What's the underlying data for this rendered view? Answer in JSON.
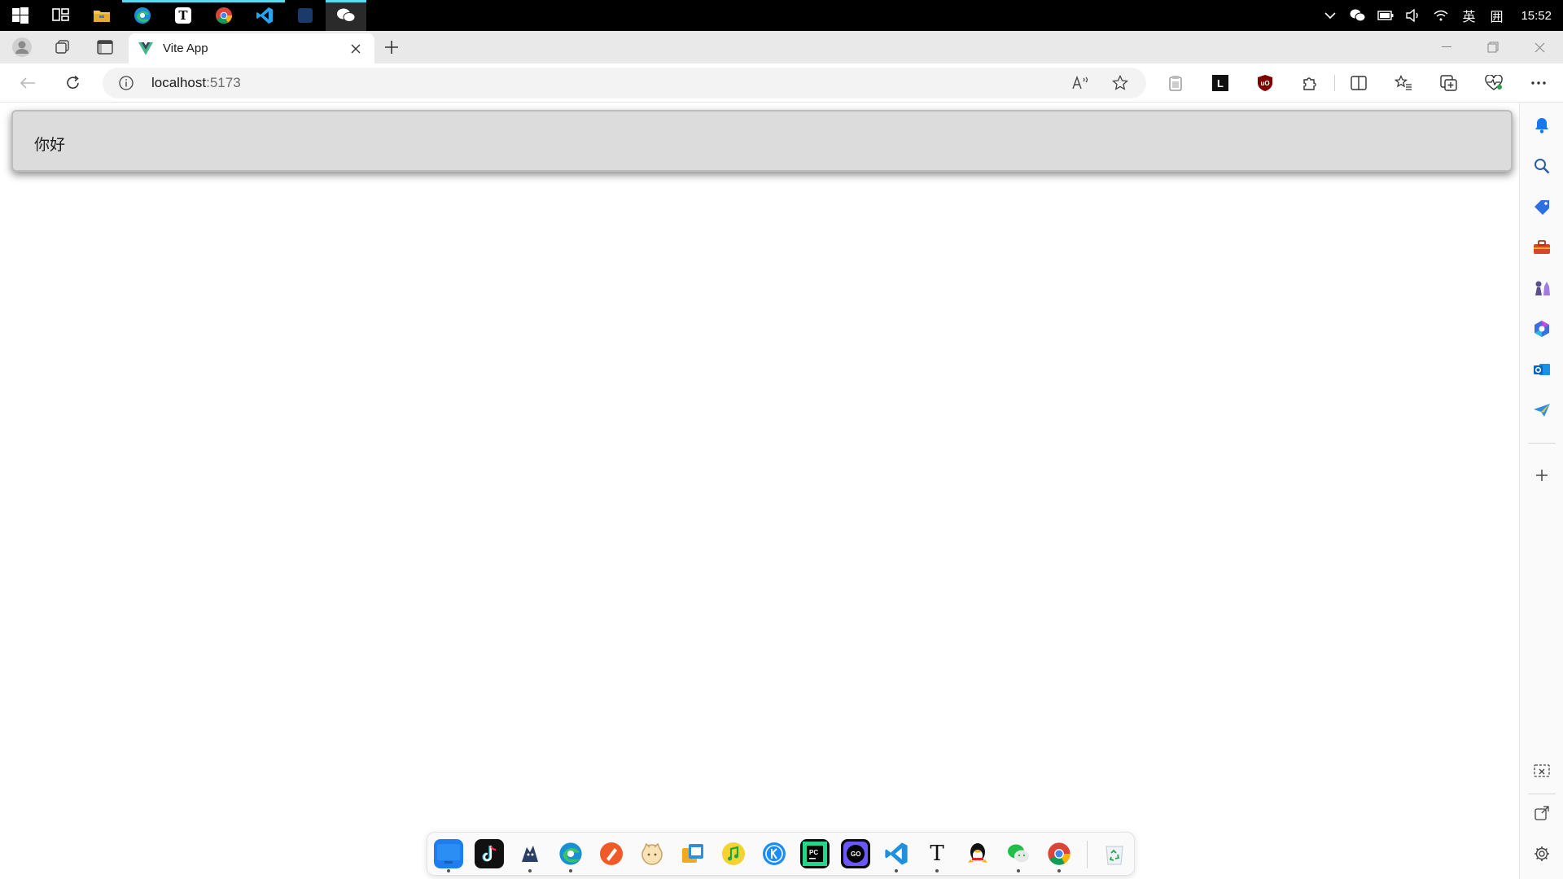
{
  "taskbar": {
    "apps": [
      {
        "name": "start",
        "icon": "windows-logo-icon"
      },
      {
        "name": "task-view",
        "icon": "task-view-icon"
      },
      {
        "name": "file-explorer",
        "icon": "folder-icon"
      },
      {
        "name": "edge",
        "icon": "edge-icon"
      },
      {
        "name": "typora",
        "icon": "typora-icon"
      },
      {
        "name": "chrome",
        "icon": "chrome-icon"
      },
      {
        "name": "vscode",
        "icon": "vscode-icon"
      },
      {
        "name": "penguin",
        "icon": "penguin-icon"
      },
      {
        "name": "wechat",
        "icon": "wechat-icon"
      }
    ],
    "tray": {
      "ime_lang": "英",
      "ime_mode": "囲",
      "time": "15:52"
    }
  },
  "browser": {
    "tab_title": "Vite App",
    "url_host": "localhost",
    "url_port": ":5173"
  },
  "page": {
    "greeting": "你好"
  },
  "colors": {
    "taskbar_bg": "#000000",
    "taskbar_active": "#5fd4f4",
    "content_box": "#dcdcdc",
    "vue_green": "#41b883",
    "vue_dark": "#34495e"
  }
}
